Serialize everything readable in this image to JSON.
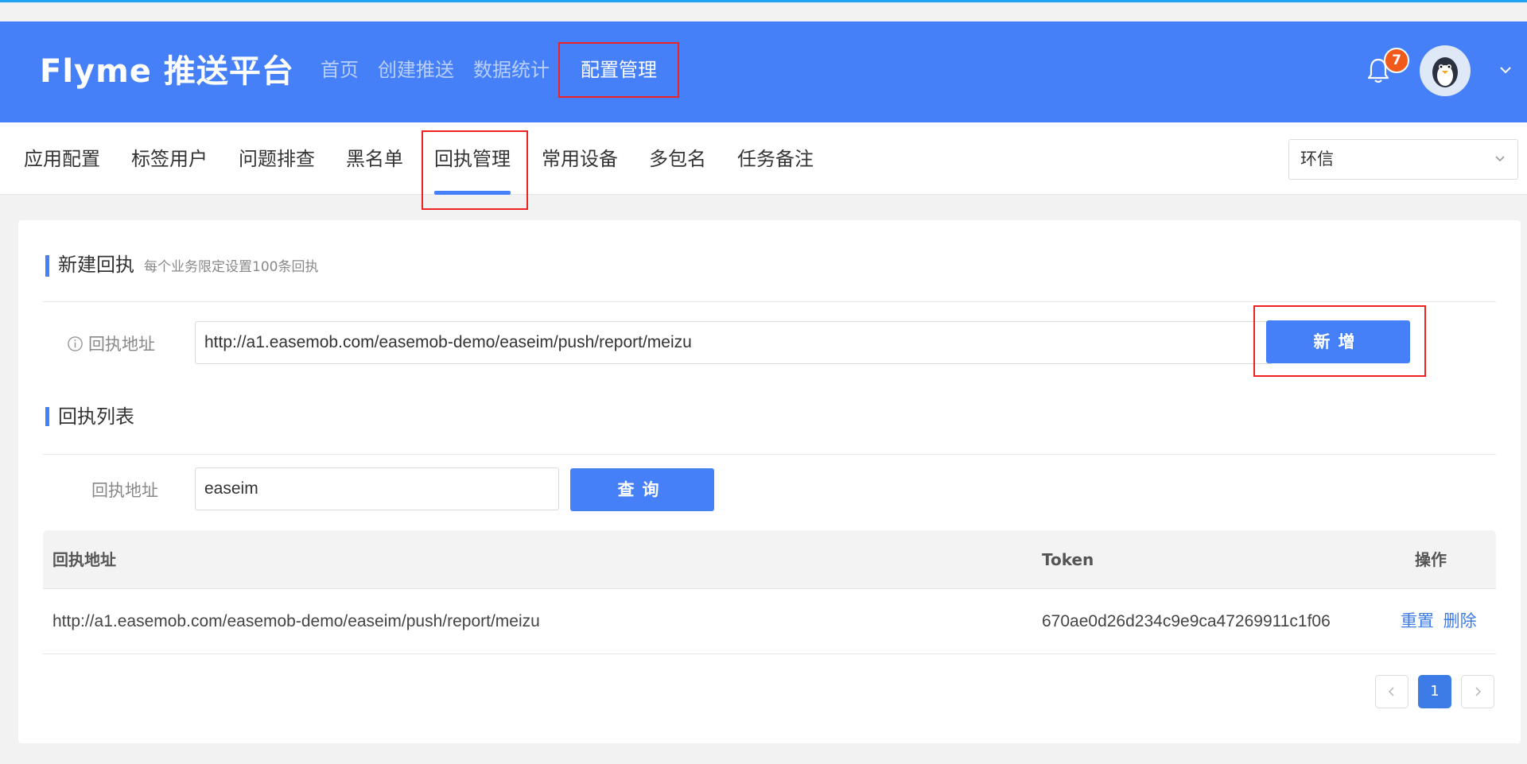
{
  "header": {
    "logo": "Flyme 推送平台",
    "nav": [
      {
        "label": "首页"
      },
      {
        "label": "创建推送"
      },
      {
        "label": "数据统计"
      },
      {
        "label": "配置管理"
      }
    ],
    "notification_count": "7"
  },
  "subnav": {
    "tabs": [
      {
        "label": "应用配置"
      },
      {
        "label": "标签用户"
      },
      {
        "label": "问题排查"
      },
      {
        "label": "黑名单"
      },
      {
        "label": "回执管理"
      },
      {
        "label": "常用设备"
      },
      {
        "label": "多包名"
      },
      {
        "label": "任务备注"
      }
    ],
    "app_select_value": "环信"
  },
  "new_receipt": {
    "title": "新建回执",
    "hint": "每个业务限定设置100条回执",
    "address_label": "回执地址",
    "address_value": "http://a1.easemob.com/easemob-demo/easeim/push/report/meizu",
    "add_button": "新增"
  },
  "receipt_list": {
    "title": "回执列表",
    "search_label": "回执地址",
    "search_value": "easeim",
    "query_button": "查询",
    "columns": {
      "address": "回执地址",
      "token": "Token",
      "actions": "操作"
    },
    "rows": [
      {
        "address": "http://a1.easemob.com/easemob-demo/easeim/push/report/meizu",
        "token": "670ae0d26d234c9e9ca47269911c1f06",
        "reset": "重置",
        "delete": "删除"
      }
    ],
    "current_page": "1"
  },
  "colors": {
    "primary": "#4680f8",
    "highlight": "#e22222",
    "badge": "#f25a1c"
  }
}
